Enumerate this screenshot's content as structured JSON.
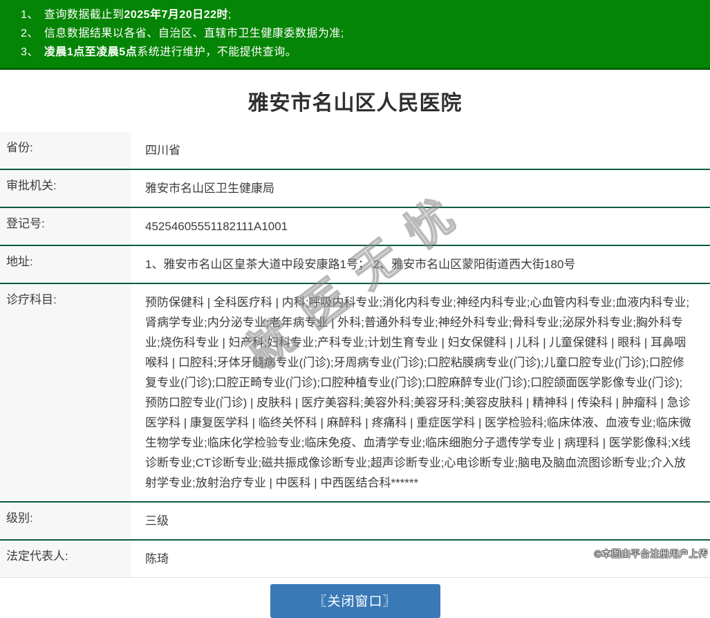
{
  "notice": {
    "bg_color": "#058505",
    "text_color": "#ffffff",
    "items": [
      {
        "num": "1、",
        "pre": "查询数据截止到",
        "bold": "2025年7月20日22时",
        "post": ";"
      },
      {
        "num": "2、",
        "pre": "信息数据结果以各省、自治区、直辖市卫生健康委数据为准;",
        "bold": "",
        "post": ""
      },
      {
        "num": "3、",
        "pre": "",
        "bold": "凌晨1点至凌晨5点",
        "post": "系统进行维护，不能提供查询。"
      }
    ]
  },
  "title": "雅安市名山区人民医院",
  "table": {
    "border_color": "#0b5c3a",
    "label_bg": "#f7f7f7",
    "rows": [
      {
        "label": "省份:",
        "value": "四川省"
      },
      {
        "label": "审批机关:",
        "value": "雅安市名山区卫生健康局"
      },
      {
        "label": "登记号:",
        "value": "45254605551182111A1001"
      },
      {
        "label": "地址:",
        "value": "1、雅安市名山区皇茶大道中段安康路1号； 2、雅安市名山区蒙阳街道西大街180号"
      },
      {
        "label": "诊疗科目:",
        "value": "预防保健科 | 全科医疗科 | 内科;呼吸内科专业;消化内科专业;神经内科专业;心血管内科专业;血液内科专业;肾病学专业;内分泌专业;老年病专业 | 外科;普通外科专业;神经外科专业;骨科专业;泌尿外科专业;胸外科专业;烧伤科专业 | 妇产科;妇科专业;产科专业;计划生育专业 | 妇女保健科 | 儿科 | 儿童保健科 | 眼科 | 耳鼻咽喉科 | 口腔科;牙体牙髓病专业(门诊);牙周病专业(门诊);口腔粘膜病专业(门诊);儿童口腔专业(门诊);口腔修复专业(门诊);口腔正畸专业(门诊);口腔种植专业(门诊);口腔麻醉专业(门诊);口腔颌面医学影像专业(门诊);预防口腔专业(门诊) | 皮肤科 | 医疗美容科;美容外科;美容牙科;美容皮肤科 | 精神科 | 传染科 | 肿瘤科 | 急诊医学科 | 康复医学科 | 临终关怀科 | 麻醉科 | 疼痛科 | 重症医学科 | 医学检验科;临床体液、血液专业;临床微生物学专业;临床化学检验专业;临床免疫、血清学专业;临床细胞分子遗传学专业 | 病理科 | 医学影像科;X线诊断专业;CT诊断专业;磁共振成像诊断专业;超声诊断专业;心电诊断专业;脑电及脑血流图诊断专业;介入放射学专业;放射治疗专业 | 中医科 | 中西医结合科******"
      },
      {
        "label": "级别:",
        "value": "三级"
      },
      {
        "label": "法定代表人:",
        "value": "陈琦"
      }
    ]
  },
  "close_button": {
    "label": "〖关闭窗口〗",
    "color": "#3a79b7"
  },
  "watermark": {
    "diagonal_text": "就医无忧",
    "corner_text": "©本图由平台注册用户上传"
  }
}
